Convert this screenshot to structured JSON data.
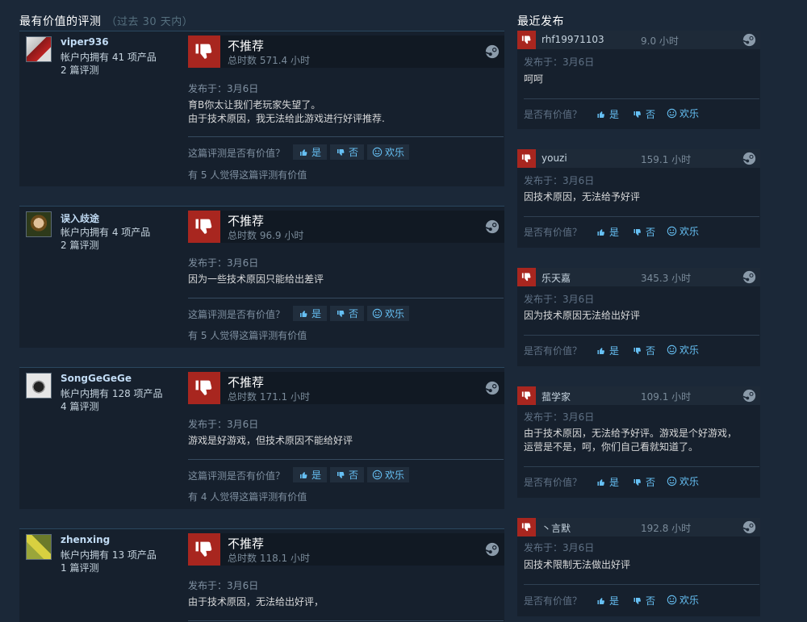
{
  "left_section": {
    "title": "最有价值的评测",
    "subtitle": "（过去 30 天内）"
  },
  "right_section": {
    "title": "最近发布"
  },
  "reviews": [
    {
      "author": "viper936",
      "products": "帐户内拥有 41 项产品",
      "review_count": "2 篇评测",
      "verdict": "不推荐",
      "hours": "总时数 571.4 小时",
      "posted": "发布于：3月6日",
      "text_lines": [
        "育B你太让我们老玩家失望了。",
        "由于技术原因，我无法给此游戏进行好评推荐."
      ],
      "helpful_question": "这篇评测是否有价值？",
      "yes": "是",
      "no": "否",
      "funny": "欢乐",
      "helpful_count": "有 5 人觉得这篇评测有价值"
    },
    {
      "author": "误入歧途",
      "products": "帐户内拥有 4 项产品",
      "review_count": "2 篇评测",
      "verdict": "不推荐",
      "hours": "总时数 96.9 小时",
      "posted": "发布于：3月6日",
      "text_lines": [
        "因为一些技术原因只能给出差评"
      ],
      "helpful_question": "这篇评测是否有价值？",
      "yes": "是",
      "no": "否",
      "funny": "欢乐",
      "helpful_count": "有 5 人觉得这篇评测有价值"
    },
    {
      "author": "SongGeGeGe",
      "products": "帐户内拥有 128 项产品",
      "review_count": "4 篇评测",
      "verdict": "不推荐",
      "hours": "总时数 171.1 小时",
      "posted": "发布于：3月6日",
      "text_lines": [
        "游戏是好游戏，但技术原因不能给好评"
      ],
      "helpful_question": "这篇评测是否有价值？",
      "yes": "是",
      "no": "否",
      "funny": "欢乐",
      "helpful_count": "有 4 人觉得这篇评测有价值"
    },
    {
      "author": "zhenxing",
      "products": "帐户内拥有 13 项产品",
      "review_count": "1 篇评测",
      "verdict": "不推荐",
      "hours": "总时数 118.1 小时",
      "posted": "发布于：3月6日",
      "text_lines": [
        "由于技术原因，无法给出好评，"
      ]
    }
  ],
  "recent": [
    {
      "name": "rhf19971103",
      "hours": "9.0 小时",
      "posted": "发布于：3月6日",
      "text_lines": [
        "呵呵"
      ],
      "question": "是否有价值？",
      "yes": "是",
      "no": "否",
      "funny": "欢乐"
    },
    {
      "name": "youzi",
      "hours": "159.1 小时",
      "posted": "发布于：3月6日",
      "text_lines": [
        "因技术原因，无法给予好评"
      ],
      "question": "是否有价值？",
      "yes": "是",
      "no": "否",
      "funny": "欢乐"
    },
    {
      "name": "乐天嘉",
      "hours": "345.3 小时",
      "posted": "发布于：3月6日",
      "text_lines": [
        "因为技术原因无法给出好评"
      ],
      "question": "是否有价值？",
      "yes": "是",
      "no": "否",
      "funny": "欢乐"
    },
    {
      "name": "菰学家",
      "hours": "109.1 小时",
      "posted": "发布于：3月6日",
      "text_lines": [
        "由于技术原因，无法给予好评。游戏是个好游戏，",
        "运营是不是，呵，你们自己看就知道了。"
      ],
      "question": "是否有价值？",
      "yes": "是",
      "no": "否",
      "funny": "欢乐"
    },
    {
      "name": "丶言默",
      "hours": "192.8 小时",
      "posted": "发布于：3月6日",
      "text_lines": [
        "因技术限制无法做出好评"
      ],
      "question": "是否有价值？",
      "yes": "是",
      "no": "否",
      "funny": "欢乐"
    }
  ],
  "icons": {
    "thumbs_down": "thumbs-down-icon",
    "thumbs_up": "thumbs-up-icon",
    "smile": "smile-icon",
    "steam": "steam-icon"
  },
  "colors": {
    "background": "#1b2838",
    "card": "#16202d",
    "negative": "#a8261f",
    "link": "#66c0f4"
  }
}
